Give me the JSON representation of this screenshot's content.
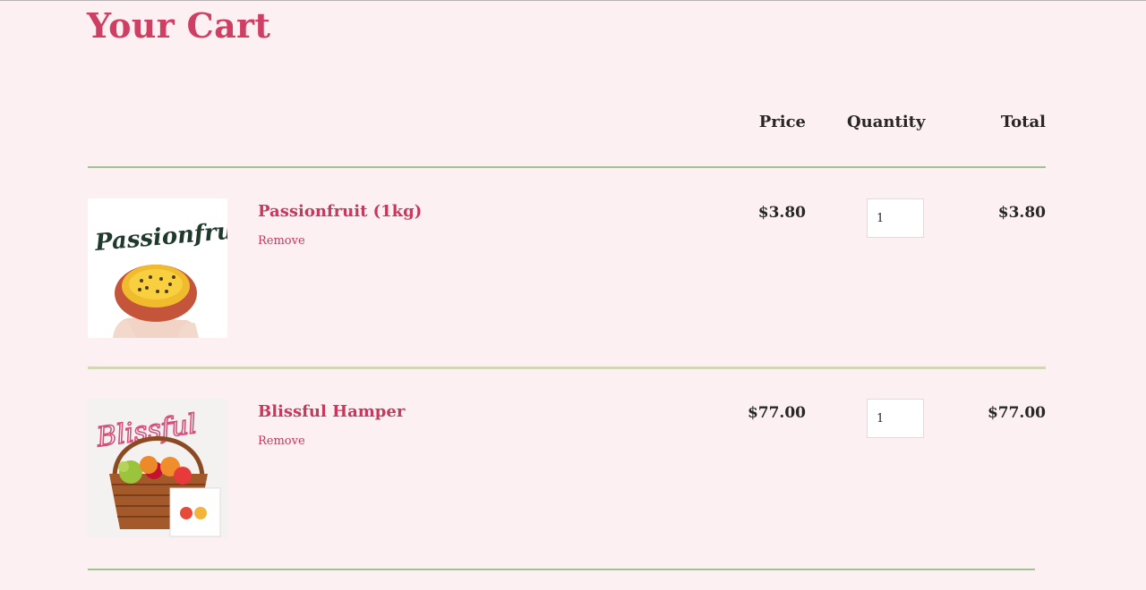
{
  "page": {
    "title": "Your Cart"
  },
  "table_header": {
    "price": "Price",
    "quantity": "Quantity",
    "total": "Total"
  },
  "items": [
    {
      "name": "Passionfruit (1kg)",
      "remove_label": "Remove",
      "price": "$3.80",
      "quantity": "1",
      "total": "$3.80",
      "image_text": "Passionfruit",
      "image_icon": "passionfruit-icon"
    },
    {
      "name": "Blissful Hamper",
      "remove_label": "Remove",
      "price": "$77.00",
      "quantity": "1",
      "total": "$77.00",
      "image_text": "Blissful",
      "image_icon": "fruit-basket-icon"
    }
  ],
  "colors": {
    "background": "#fcf0f2",
    "accent": "#cf3f64",
    "divider": "#9fc391",
    "text": "#272727"
  }
}
